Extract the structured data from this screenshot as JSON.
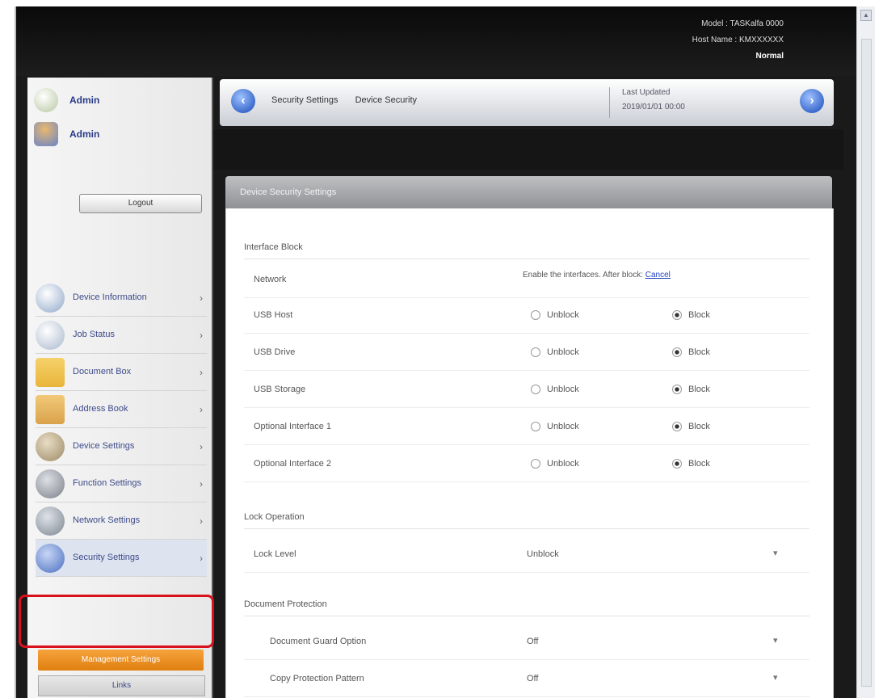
{
  "header": {
    "line1": "Model : TASKalfa 0000",
    "line2": "Host Name : KMXXXXXX",
    "status": "Normal"
  },
  "sidebar": {
    "user": {
      "top_label": "Admin",
      "user_label": "Admin"
    },
    "logout_label": "Logout",
    "menu": [
      {
        "label": "Device Information",
        "icon": "device-info-icon",
        "color": "#8fa7c8"
      },
      {
        "label": "Job Status",
        "icon": "job-status-icon",
        "color": "#a9b7cc"
      },
      {
        "label": "Document Box",
        "icon": "document-box-icon",
        "color": "#e8b53a"
      },
      {
        "label": "Address Book",
        "icon": "address-book-icon",
        "color": "#d9a24a"
      },
      {
        "label": "Device Settings",
        "icon": "device-settings-icon",
        "color": "#9c8a66"
      },
      {
        "label": "Function Settings",
        "icon": "function-settings-icon",
        "color": "#7a7f88"
      },
      {
        "label": "Network Settings",
        "icon": "network-settings-icon",
        "color": "#7c8590"
      },
      {
        "label": "Security Settings",
        "icon": "security-settings-icon",
        "color": "#4a6ec0"
      }
    ],
    "orange_label": "Management Settings",
    "bottom_label": "Links"
  },
  "nav": {
    "crumbs": [
      "Security Settings",
      "Device Security"
    ],
    "info_line1": "Last Updated",
    "info_line2": "2019/01/01 00:00"
  },
  "panel": {
    "title": "Device Security Settings",
    "sec1": "Interface Block",
    "note_text": "Enable the interfaces. After block:",
    "note_link": "Cancel",
    "rows": [
      {
        "label": "Network",
        "opt1": "",
        "opt2": ""
      },
      {
        "label": "USB Host",
        "opt1": "Unblock",
        "opt2": "Block"
      },
      {
        "label": "USB Drive",
        "opt1": "Unblock",
        "opt2": "Block"
      },
      {
        "label": "USB Storage",
        "opt1": "Unblock",
        "opt2": "Block"
      },
      {
        "label": "Optional Interface 1",
        "opt1": "Unblock",
        "opt2": "Block"
      },
      {
        "label": "Optional Interface 2",
        "opt1": "Unblock",
        "opt2": "Block"
      }
    ],
    "sec2": "Lock Operation",
    "lock_label": "Lock Level",
    "lock_value": "Unblock",
    "sec3": "Document Protection",
    "doc_rows": [
      {
        "label": "Document Guard Option",
        "value": "Off"
      },
      {
        "label": "Copy Protection Pattern",
        "value": "Off"
      }
    ]
  }
}
